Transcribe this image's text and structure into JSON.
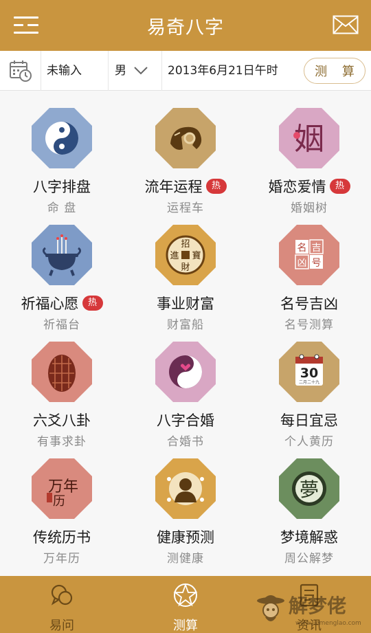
{
  "header": {
    "title": "易奇八字",
    "menu_icon": "menu-icon",
    "mail_icon": "mail-icon"
  },
  "input_bar": {
    "calendar_icon": "calendar-clock-icon",
    "name_value": "未输入",
    "gender_value": "男",
    "birth_value": "2013年6月21日午时",
    "calculate_label": "测 算"
  },
  "hot_label": "热",
  "items": [
    {
      "title": "八字排盘",
      "subtitle": "命 盘",
      "hot": false,
      "icon": "yin-yang-icon",
      "color": "#8fa9cf"
    },
    {
      "title": "流年运程",
      "subtitle": "运程车",
      "hot": true,
      "icon": "ram-icon",
      "color": "#c7a46a"
    },
    {
      "title": "婚恋爱情",
      "subtitle": "婚姻树",
      "hot": true,
      "icon": "marriage-character-icon",
      "color": "#d9a7c4"
    },
    {
      "title": "祈福心愿",
      "subtitle": "祈福台",
      "hot": true,
      "icon": "incense-burner-icon",
      "color": "#7e9bc7"
    },
    {
      "title": "事业财富",
      "subtitle": "财富船",
      "hot": false,
      "icon": "coin-icon",
      "color": "#d9a44a"
    },
    {
      "title": "名号吉凶",
      "subtitle": "名号测算",
      "hot": false,
      "icon": "name-seal-icon",
      "color": "#d98a7e"
    },
    {
      "title": "六爻八卦",
      "subtitle": "有事求卦",
      "hot": false,
      "icon": "tortoise-shell-icon",
      "color": "#d98a7e"
    },
    {
      "title": "八字合婚",
      "subtitle": "合婚书",
      "hot": false,
      "icon": "heart-yin-yang-icon",
      "color": "#d9a7c4"
    },
    {
      "title": "每日宜忌",
      "subtitle": "个人黄历",
      "hot": false,
      "icon": "calendar-30-icon",
      "color": "#c7a46a"
    },
    {
      "title": "传统历书",
      "subtitle": "万年历",
      "hot": false,
      "icon": "almanac-icon",
      "color": "#d98a7e"
    },
    {
      "title": "健康预测",
      "subtitle": "测健康",
      "hot": false,
      "icon": "health-person-icon",
      "color": "#d9a44a"
    },
    {
      "title": "梦境解惑",
      "subtitle": "周公解梦",
      "hot": false,
      "icon": "dream-icon",
      "color": "#6c8e5e"
    }
  ],
  "icon_text": {
    "marriage": "姻",
    "coin": [
      "招",
      "進",
      "寶",
      "財"
    ],
    "seal": [
      "名",
      "吉",
      "凶",
      "号"
    ],
    "calendar_day": "30",
    "calendar_lunar": "二月二十九",
    "almanac_big": "万年",
    "almanac_small": "历",
    "dream": "夢"
  },
  "tabs": [
    {
      "label": "易问",
      "icon": "chat-bubbles-icon",
      "active": false
    },
    {
      "label": "测算",
      "icon": "bagua-star-icon",
      "active": true
    },
    {
      "label": "资讯",
      "icon": "news-icon",
      "active": false
    }
  ],
  "watermark": {
    "text": "解梦佬",
    "sub": "www.jiemenglao.com"
  },
  "colors": {
    "header": "#c9953f",
    "accent_text": "#8b6a2e",
    "hot_badge": "#d6383a"
  }
}
